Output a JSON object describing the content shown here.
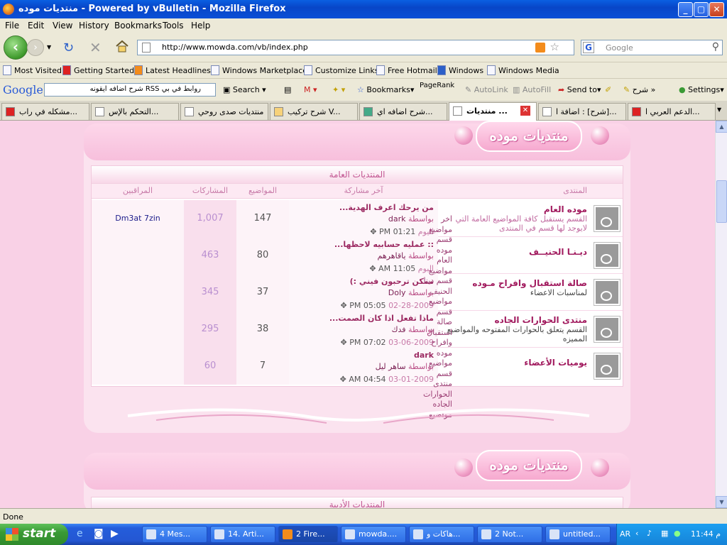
{
  "window": {
    "title": "منتديات موده - Powered by vBulletin - Mozilla Firefox"
  },
  "menu": [
    "File",
    "Edit",
    "View",
    "History",
    "Bookmarks",
    "Tools",
    "Help"
  ],
  "nav": {
    "url": "http://www.mowda.com/vb/index.php",
    "search_placeholder": "Google"
  },
  "bookmarks": [
    "Most Visited",
    "Getting Started",
    "Latest Headlines",
    "Windows Marketplace",
    "Customize Links",
    "Free Hotmail",
    "Windows",
    "Windows Media"
  ],
  "google_toolbar": {
    "logo": "Google",
    "query": "روابط في بي RSS شرح اضافه ايقونه",
    "search": "Search",
    "bookmarks": "Bookmarks",
    "pagerank": "PageRank",
    "autolink": "AutoLink",
    "autofill": "AutoFill",
    "sendto": "Send to",
    "sharh": "شرح",
    "settings": "Settings"
  },
  "tabs": [
    "مشكله في راب...",
    "التحكم بالإس...",
    "منتديات صدى روحي",
    "شرح تركيب V...",
    "شرح اضافه اي...",
    "منتديات ...",
    "شرح] : اضافة ا]...",
    "الدعم العربي ا..."
  ],
  "forum": {
    "banner": "منتديات موده",
    "category": "المنتديات العامة",
    "category2": "المنتديات الأدبية",
    "columns": {
      "forum": "المنتدى",
      "last": "آخر مشاركة",
      "topics": "المواضيع",
      "posts": "المشاركات",
      "mods": "المراقبين"
    },
    "rows": [
      {
        "name": "موده العام",
        "desc": "القسم يستقبل كافة المواضيع العامة التي لايوجد لها قسم في المنتدى",
        "last_title": "من يرحك اعرف الهدية...",
        "by": "بواسطة",
        "last_user": "dark",
        "day": "اليوم",
        "time": "01:21 PM",
        "topics": "147",
        "posts": "1,007",
        "mods": "Dm3at 7zin"
      },
      {
        "name": "ديـنـا الحنيــف",
        "desc": "",
        "last_title": ":: عمليه حسابيه لاحظها...",
        "by": "بواسطة",
        "last_user": "ياقاهرهم",
        "day": "اليوم",
        "time": "11:05 AM",
        "topics": "80",
        "posts": "463",
        "mods": ""
      },
      {
        "name": "صالة استقبال وافراح مـوده",
        "desc": "لمناسبات الاعضاء",
        "last_title": "ممكن ترحبون فيني :)",
        "by": "بواسطة",
        "last_user": "Doly",
        "day": "02-28-2009",
        "time": "05:05 PM",
        "topics": "37",
        "posts": "345",
        "mods": ""
      },
      {
        "name": "منتدى الحوارات الجاده",
        "desc": "القسم يتعلق بالحوارات المفتوحه والمواضيع المميزه",
        "last_title": "ماذا تفعل اذا كان الصمت...",
        "by": "بواسطة",
        "last_user": "فدك",
        "day": "03-06-2009",
        "time": "07:02 PM",
        "topics": "38",
        "posts": "295",
        "mods": ""
      },
      {
        "name": "يوميات الأعضاء",
        "desc": "",
        "last_title": "dark",
        "by": "بواسطة",
        "last_user": "ساهر ليل",
        "day": "03-01-2009",
        "time": "04:54 AM",
        "topics": "7",
        "posts": "60",
        "mods": ""
      }
    ],
    "overflow_text": "اخر مواضيع قسم موده العام مواضيع قسم دينا الحنيف مواضيع قسم صالة استقبال وافراح موده مواضيع قسم منتدى الحوارات الجاده مواضيع قسم يوميات الاعضاء"
  },
  "status": "Done",
  "taskbar": {
    "start": "start",
    "buttons": [
      "4 Mes...",
      "14. Arti...",
      "2 Fire...",
      "mowda....",
      "هاكات و...",
      "2 Not...",
      "untitled..."
    ],
    "lang": "AR",
    "clock": "م 11:44"
  }
}
